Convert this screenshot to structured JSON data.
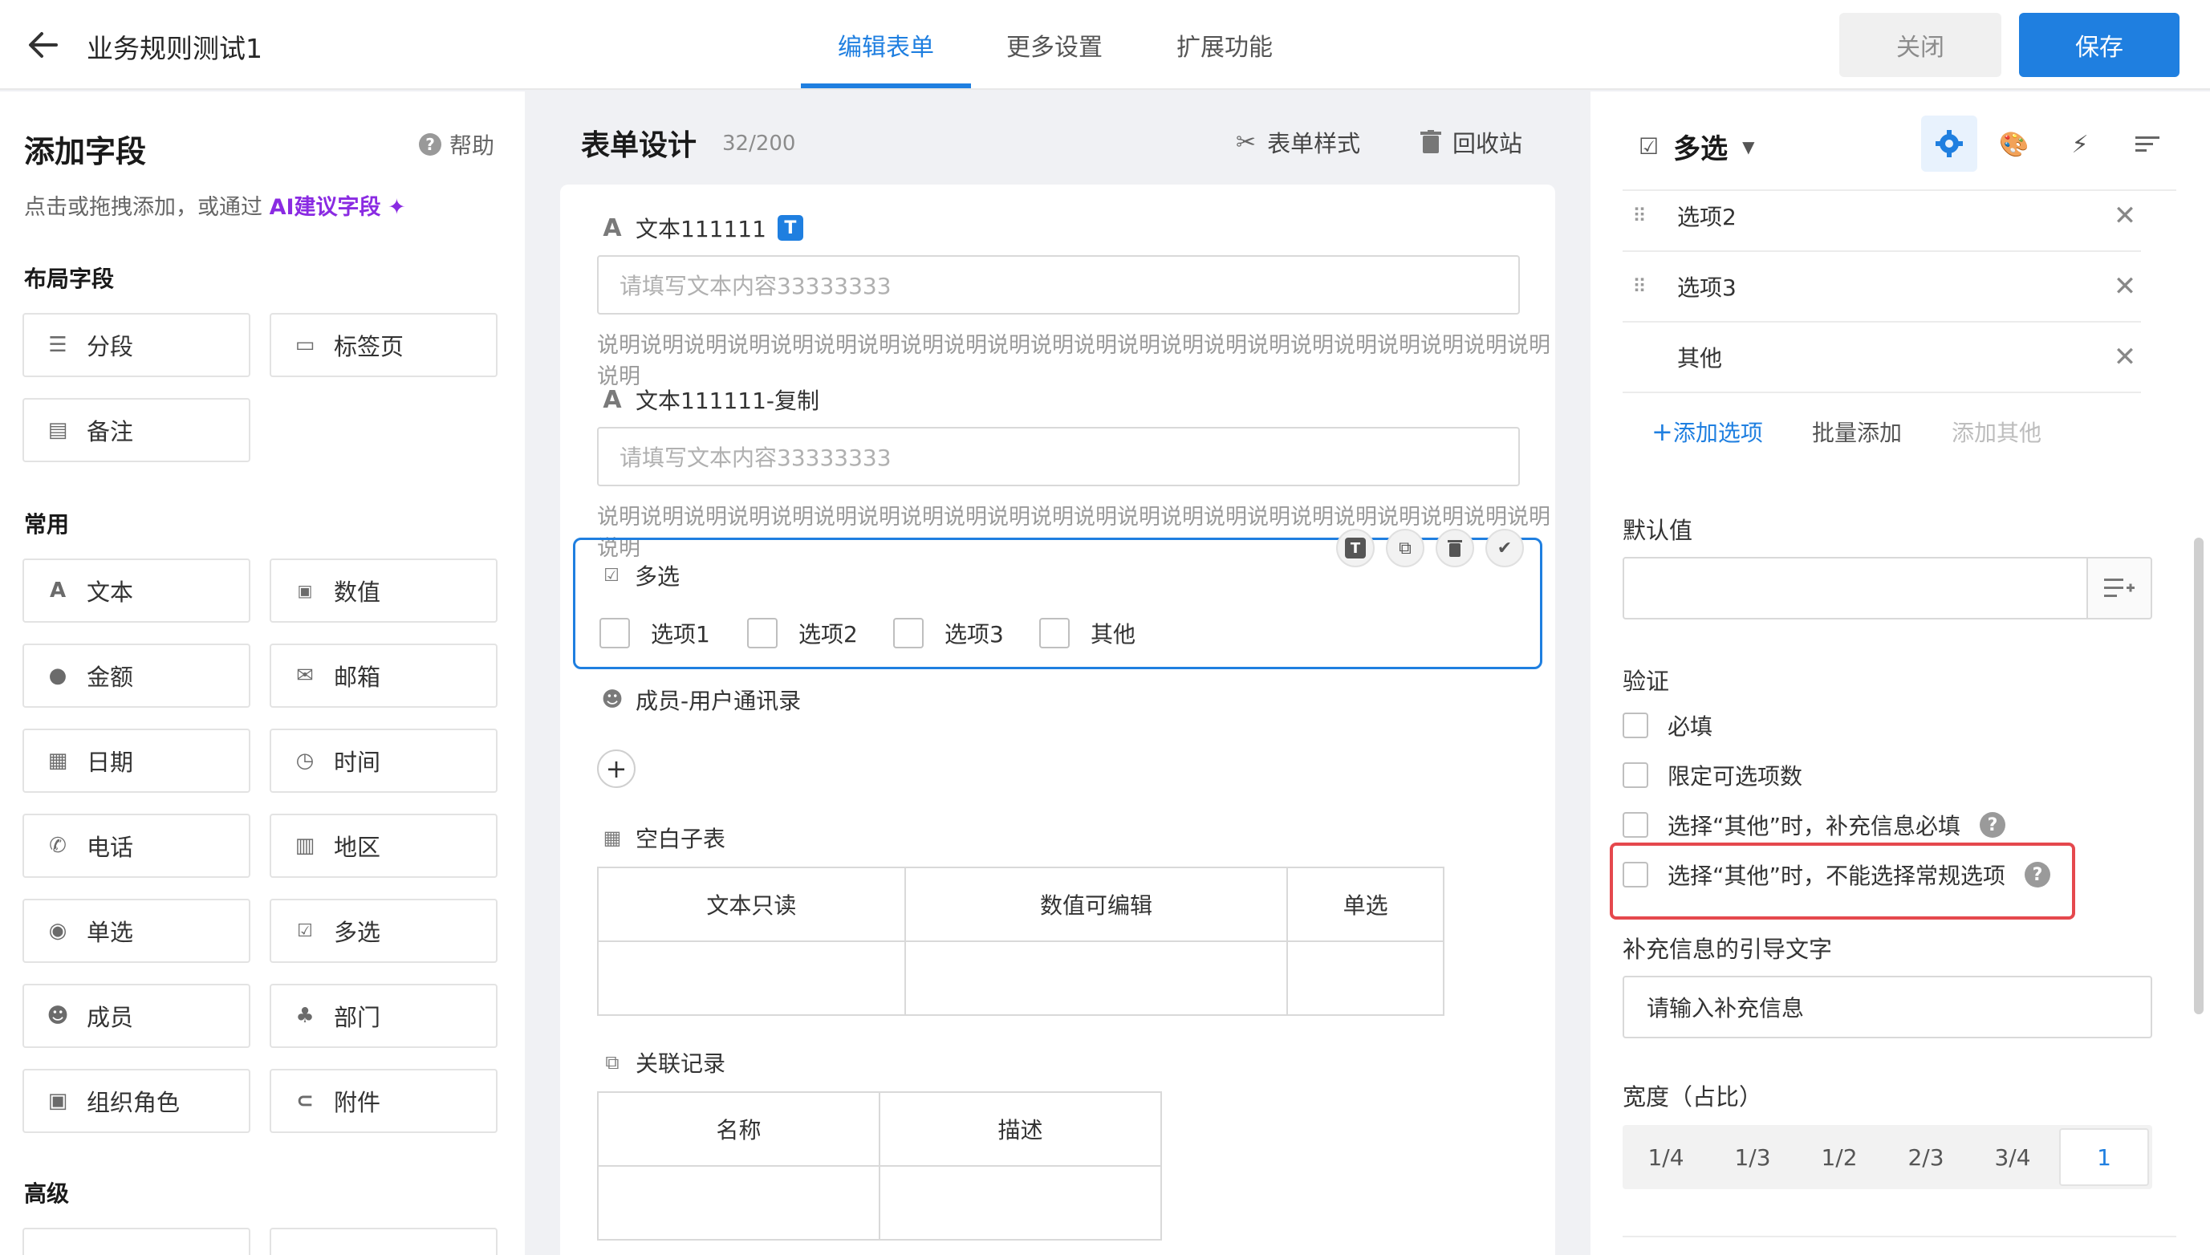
{
  "header": {
    "title": "业务规则测试1",
    "tabs": [
      {
        "label": "编辑表单",
        "active": true
      },
      {
        "label": "更多设置",
        "active": false
      },
      {
        "label": "扩展功能",
        "active": false
      }
    ],
    "close_label": "关闭",
    "save_label": "保存"
  },
  "left_panel": {
    "title": "添加字段",
    "help_label": "帮助",
    "hint_prefix": "点击或拖拽添加，或通过",
    "ai_link": "AI建议字段",
    "sections": {
      "layout": "布局字段",
      "common": "常用",
      "advanced": "高级"
    },
    "layout_fields": [
      {
        "label": "分段",
        "icon": "section-icon"
      },
      {
        "label": "标签页",
        "icon": "tabs-icon"
      },
      {
        "label": "备注",
        "icon": "note-icon"
      }
    ],
    "common_fields": [
      {
        "label": "文本",
        "icon": "text-icon"
      },
      {
        "label": "数值",
        "icon": "number-icon"
      },
      {
        "label": "金额",
        "icon": "money-icon"
      },
      {
        "label": "邮箱",
        "icon": "mail-icon"
      },
      {
        "label": "日期",
        "icon": "calendar-icon"
      },
      {
        "label": "时间",
        "icon": "clock-icon"
      },
      {
        "label": "电话",
        "icon": "phone-icon"
      },
      {
        "label": "地区",
        "icon": "map-icon"
      },
      {
        "label": "单选",
        "icon": "radio-icon"
      },
      {
        "label": "多选",
        "icon": "checklist-icon"
      },
      {
        "label": "成员",
        "icon": "user-icon"
      },
      {
        "label": "部门",
        "icon": "org-icon"
      },
      {
        "label": "组织角色",
        "icon": "role-icon"
      },
      {
        "label": "附件",
        "icon": "paperclip-icon"
      }
    ]
  },
  "center": {
    "title": "表单设计",
    "count": "32/200",
    "form_style_label": "表单样式",
    "recycle_label": "回收站",
    "fields": {
      "text1": {
        "label": "文本111111",
        "placeholder": "请填写文本内容33333333",
        "description": "说明说明说明说明说明说明说明说明说明说明说明说明说明说明说明说明说明说明说明说明说明说明说明"
      },
      "text2": {
        "label": "文本111111-复制",
        "placeholder": "请填写文本内容33333333",
        "description": "说明说明说明说明说明说明说明说明说明说明说明说明说明说明说明说明说明说明说明说明说明说明说明"
      },
      "multi": {
        "label": "多选",
        "options": [
          "选项1",
          "选项2",
          "选项3",
          "其他"
        ]
      },
      "member": {
        "label": "成员-用户通讯录"
      },
      "subtable": {
        "label": "空白子表",
        "columns": [
          "文本只读",
          "数值可编辑",
          "单选"
        ]
      },
      "related": {
        "label": "关联记录",
        "columns": [
          "名称",
          "描述"
        ]
      }
    }
  },
  "right_panel": {
    "field_type": "多选",
    "options": [
      {
        "label": "选项2"
      },
      {
        "label": "选项3"
      },
      {
        "label": "其他"
      }
    ],
    "add_option": "添加选项",
    "batch_add": "批量添加",
    "add_other": "添加其他",
    "default_value_label": "默认值",
    "validation_label": "验证",
    "validations": [
      {
        "label": "必填",
        "checked": false
      },
      {
        "label": "限定可选项数",
        "checked": false
      },
      {
        "label": "选择“其他”时，补充信息必填",
        "checked": false,
        "help": true
      },
      {
        "label": "选择“其他”时，不能选择常规选项",
        "checked": false,
        "help": true
      }
    ],
    "supplement_label": "补充信息的引导文字",
    "supplement_value": "请输入补充信息",
    "width_label": "宽度（占比）",
    "width_options": [
      "1/4",
      "1/3",
      "1/2",
      "2/3",
      "3/4",
      "1"
    ],
    "width_selected": "1"
  },
  "colors": {
    "primary": "#1f7fe0",
    "ai": "#8a2be2",
    "highlight": "#e5484d"
  }
}
